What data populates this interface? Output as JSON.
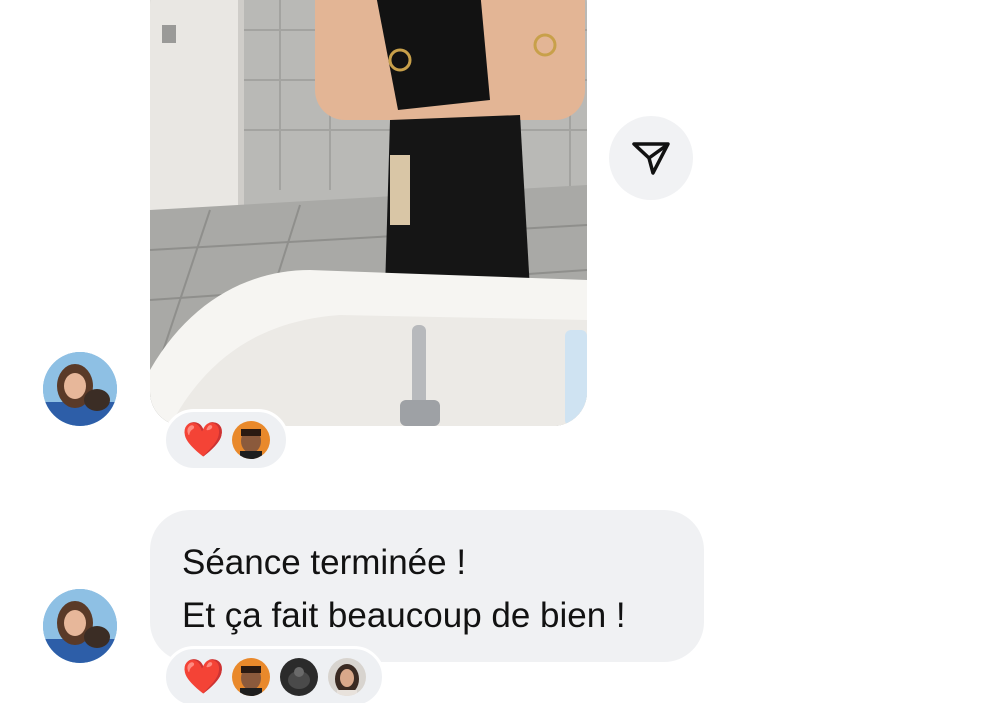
{
  "messages": [
    {
      "type": "photo",
      "image": "mirror-selfie-photo",
      "share_icon": "paper-plane-icon",
      "reactions": {
        "emoji": "❤️",
        "reactor_avatars": [
          "reactor-avatar-1"
        ]
      }
    },
    {
      "type": "text",
      "lines": [
        "Séance terminée !",
        "Et ça fait beaucoup de bien !"
      ],
      "reactions": {
        "emoji": "❤️",
        "reactor_avatars": [
          "reactor-avatar-1",
          "reactor-avatar-2",
          "reactor-avatar-3"
        ]
      }
    }
  ],
  "colors": {
    "bubble_bg": "#f0f1f3",
    "text": "#121212",
    "heart": "#e0213c"
  }
}
